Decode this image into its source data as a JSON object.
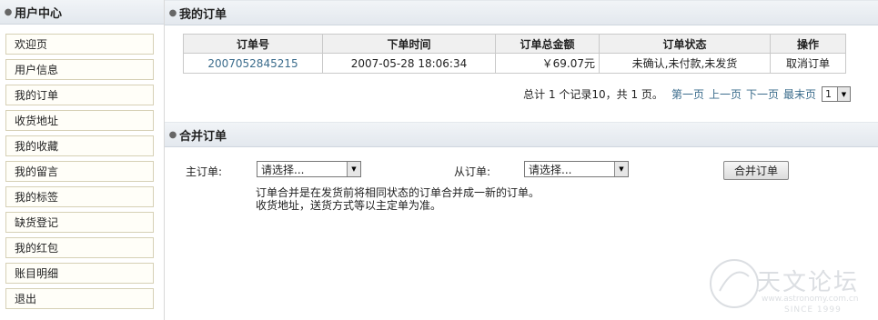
{
  "sidebar": {
    "title": "用户中心",
    "items": [
      {
        "label": "欢迎页"
      },
      {
        "label": "用户信息"
      },
      {
        "label": "我的订单"
      },
      {
        "label": "收货地址"
      },
      {
        "label": "我的收藏"
      },
      {
        "label": "我的留言"
      },
      {
        "label": "我的标签"
      },
      {
        "label": "缺货登记"
      },
      {
        "label": "我的红包"
      },
      {
        "label": "账目明细"
      },
      {
        "label": "退出"
      }
    ]
  },
  "orders": {
    "title": "我的订单",
    "columns": [
      "订单号",
      "下单时间",
      "订单总金额",
      "订单状态",
      "操作"
    ],
    "rows": [
      {
        "order_no": "2007052845215",
        "time": "2007-05-28 18:06:34",
        "amount": "￥69.07元",
        "status": "未确认,未付款,未发货",
        "action": "取消订单"
      }
    ],
    "pager": {
      "summary": "总计 1 个记录10，共 1 页。",
      "first": "第一页",
      "prev": "上一页",
      "next": "下一页",
      "last": "最末页",
      "current_page": "1"
    }
  },
  "merge": {
    "title": "合并订单",
    "main_label": "主订单:",
    "main_value": "请选择...",
    "sub_label": "从订单:",
    "sub_value": "请选择...",
    "button": "合并订单",
    "note_line1": "订单合并是在发货前将相同状态的订单合并成一新的订单。",
    "note_line2": "收货地址，送货方式等以主定单为准。"
  },
  "watermark": {
    "text": "天文论坛",
    "url": "www.astronomy.com.cn",
    "since": "SINCE 1999"
  }
}
